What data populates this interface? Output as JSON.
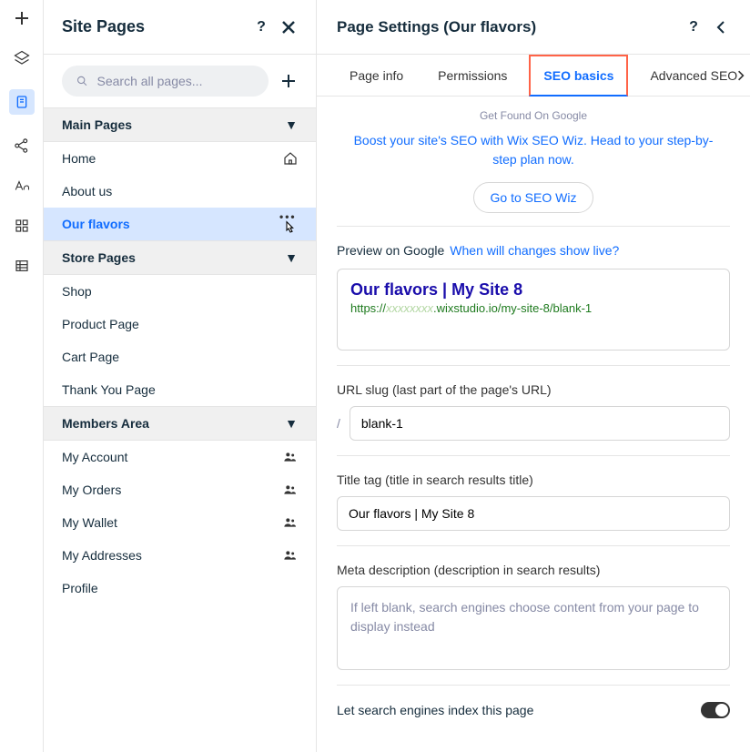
{
  "pagesPanel": {
    "title": "Site Pages",
    "search_placeholder": "Search all pages...",
    "sections": [
      {
        "label": "Main Pages"
      },
      {
        "label": "Store Pages"
      },
      {
        "label": "Members Area"
      }
    ],
    "main_pages": [
      {
        "label": "Home",
        "icon": "home-icon",
        "active": false
      },
      {
        "label": "About us",
        "active": false
      },
      {
        "label": "Our flavors",
        "active": true,
        "icon": "more-dots"
      }
    ],
    "store_pages": [
      {
        "label": "Shop"
      },
      {
        "label": "Product Page"
      },
      {
        "label": "Cart Page"
      },
      {
        "label": "Thank You Page"
      }
    ],
    "members_pages": [
      {
        "label": "My Account",
        "icon": "members-icon"
      },
      {
        "label": "My Orders",
        "icon": "members-icon"
      },
      {
        "label": "My Wallet",
        "icon": "members-icon"
      },
      {
        "label": "My Addresses",
        "icon": "members-icon"
      },
      {
        "label": "Profile"
      }
    ]
  },
  "settings": {
    "title": "Page Settings (Our flavors)",
    "tabs": [
      {
        "label": "Page info"
      },
      {
        "label": "Permissions"
      },
      {
        "label": "SEO basics",
        "active": true
      },
      {
        "label": "Advanced SEO"
      }
    ],
    "seo": {
      "heading_small": "Get Found On Google",
      "intro": "Boost your site's SEO with Wix SEO Wiz. Head to your step-by-step plan now.",
      "button": "Go to SEO Wiz",
      "preview_label": "Preview on Google",
      "preview_link": "When will changes show live?",
      "preview_title": "Our flavors | My Site 8",
      "preview_url_prefix": "https://",
      "preview_url_suffix": ".wixstudio.io/my-site-8/blank-1",
      "slug_label": "URL slug (last part of the page's URL)",
      "slug_prefix": "/",
      "slug_value": "blank-1",
      "titletag_label": "Title tag (title in search results title)",
      "titletag_value": "Our flavors | My Site 8",
      "meta_label": "Meta description (description in search results)",
      "meta_placeholder": "If left blank, search engines choose content from your page to display instead",
      "index_label": "Let search engines index this page"
    }
  }
}
